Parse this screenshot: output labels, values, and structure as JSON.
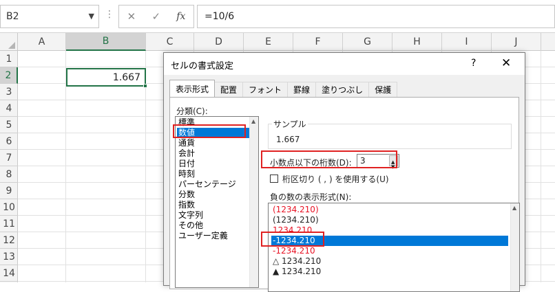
{
  "formula_bar": {
    "name_box": "B2",
    "cancel_icon": "✕",
    "enter_icon": "✓",
    "fx_label": "fx",
    "formula": "=10/6"
  },
  "grid": {
    "columns": [
      "A",
      "B",
      "C",
      "D",
      "E",
      "F",
      "G",
      "H",
      "I",
      "J"
    ],
    "rows": [
      "1",
      "2",
      "3",
      "4",
      "5",
      "6",
      "7",
      "8",
      "9",
      "10",
      "11",
      "12",
      "13",
      "14"
    ],
    "active_cell": "B2",
    "active_value": "1.667"
  },
  "dialog": {
    "title": "セルの書式設定",
    "help": "?",
    "close": "✕",
    "tabs": [
      "表示形式",
      "配置",
      "フォント",
      "罫線",
      "塗りつぶし",
      "保護"
    ],
    "active_tab": "表示形式",
    "category_label": "分類(C):",
    "categories": [
      "標準",
      "数値",
      "通貨",
      "会計",
      "日付",
      "時刻",
      "パーセンテージ",
      "分数",
      "指数",
      "文字列",
      "その他",
      "ユーザー定義"
    ],
    "selected_category": "数値",
    "sample_label": "サンプル",
    "sample_value": "1.667",
    "decimal_label": "小数点以下の桁数(D):",
    "decimal_value": "3",
    "separator_label": "桁区切り ( , ) を使用する(U)",
    "separator_checked": false,
    "negative_label": "負の数の表示形式(N):",
    "negative_formats": [
      {
        "text": "(1234.210)",
        "red": true
      },
      {
        "text": "(1234.210)",
        "red": false
      },
      {
        "text": "1234.210",
        "red": true
      },
      {
        "text": "-1234.210",
        "red": false
      },
      {
        "text": "-1234.210",
        "red": true
      },
      {
        "text": "△ 1234.210",
        "red": false
      },
      {
        "text": "▲ 1234.210",
        "red": false
      }
    ],
    "selected_negative_index": 3
  },
  "colors": {
    "excel_green": "#217346",
    "selection_blue": "#0078d7",
    "negative_red": "#e81123",
    "highlight_red": "#e02020"
  }
}
